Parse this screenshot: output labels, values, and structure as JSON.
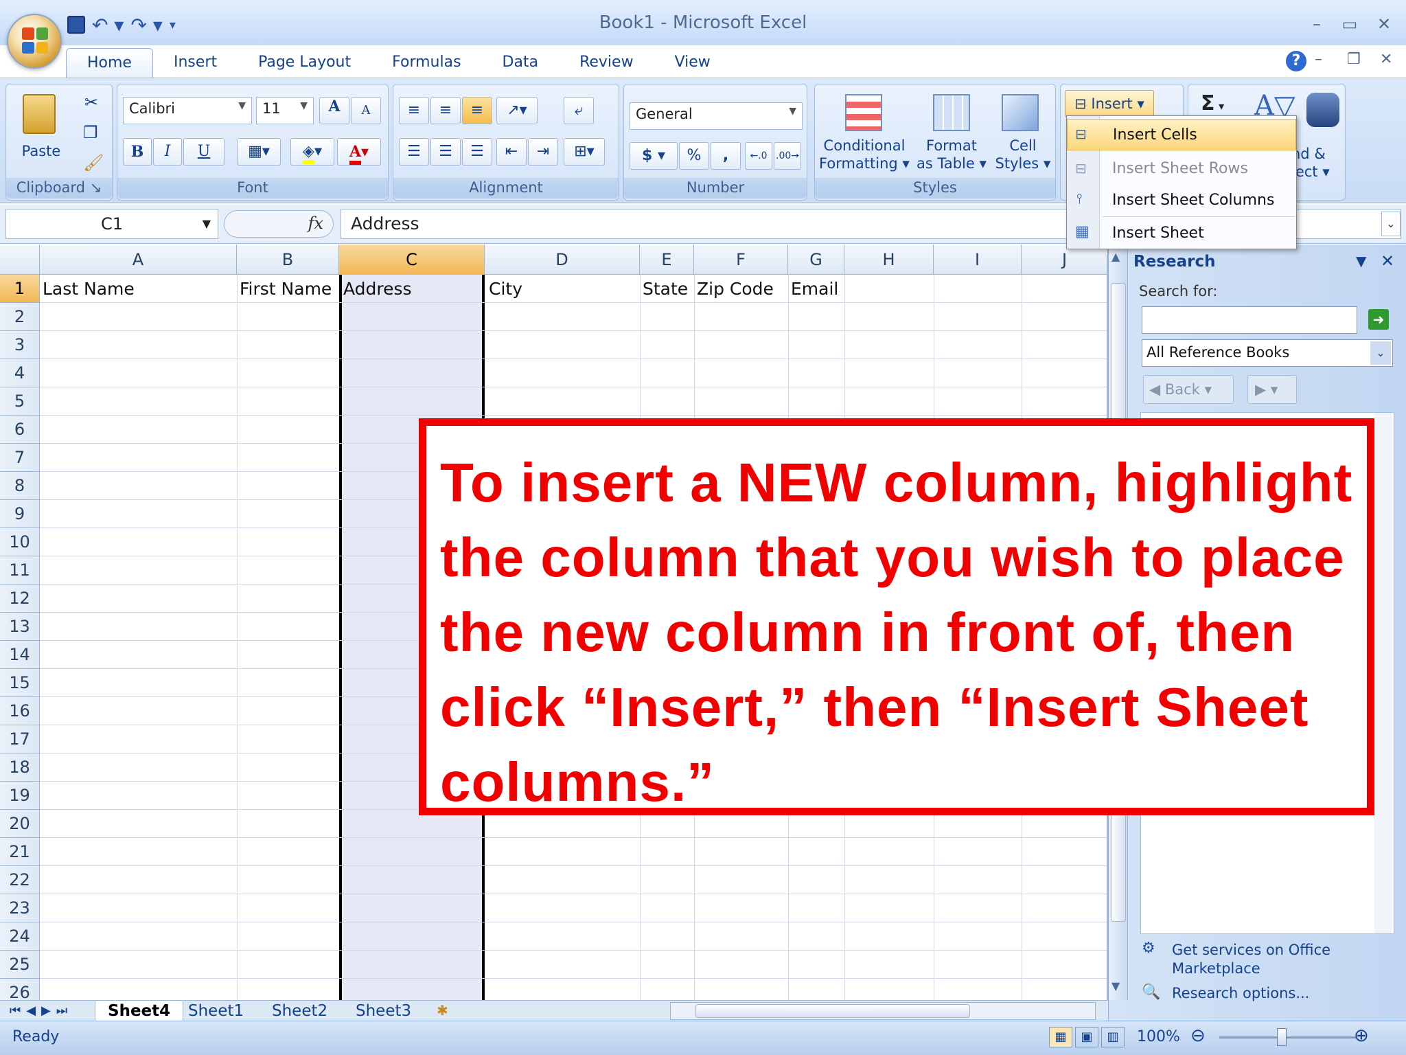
{
  "window": {
    "title": "Book1 - Microsoft Excel"
  },
  "qat": {
    "icons": [
      "save-icon",
      "undo-icon",
      "redo-icon"
    ]
  },
  "tabs": [
    "Home",
    "Insert",
    "Page Layout",
    "Formulas",
    "Data",
    "Review",
    "View"
  ],
  "ribbon": {
    "clipboard": {
      "label": "Clipboard",
      "paste": "Paste"
    },
    "font": {
      "label": "Font",
      "name": "Calibri",
      "size": "11",
      "bold": "B",
      "italic": "I",
      "underline": "U",
      "grow": "A",
      "shrink": "A"
    },
    "alignment": {
      "label": "Alignment"
    },
    "number": {
      "label": "Number",
      "format": "General",
      "currency": "$",
      "percent": "%",
      "comma": ","
    },
    "styles": {
      "label": "Styles",
      "conditional": [
        "Conditional",
        "Formatting"
      ],
      "format_table": [
        "Format",
        "as Table"
      ],
      "cell_styles": [
        "Cell",
        "Styles"
      ]
    },
    "cells": {
      "insert": "Insert"
    },
    "editing": {
      "sigma": "Σ",
      "find_partial": [
        "nd &",
        "lect"
      ]
    }
  },
  "insert_menu": [
    "Insert Cells",
    "Insert Sheet Rows",
    "Insert Sheet Columns",
    "Insert Sheet"
  ],
  "formula_bar": {
    "name_box": "C1",
    "fx": "fx",
    "value": "Address"
  },
  "grid": {
    "columns": [
      "A",
      "B",
      "C",
      "D",
      "E",
      "F",
      "G",
      "H",
      "I",
      "J"
    ],
    "rows": [
      "1",
      "2",
      "3",
      "4",
      "5",
      "6",
      "7",
      "8",
      "9",
      "10",
      "11",
      "12",
      "13",
      "14",
      "15",
      "16",
      "17",
      "18",
      "19",
      "20",
      "21",
      "22",
      "23",
      "24",
      "25",
      "26"
    ],
    "row1": [
      "Last Name",
      "First Name",
      "Address",
      "City",
      "State",
      "Zip Code",
      "Email"
    ]
  },
  "sheets": [
    "Sheet4",
    "Sheet1",
    "Sheet2",
    "Sheet3"
  ],
  "research": {
    "title": "Research",
    "search_for": "Search for:",
    "source": "All Reference Books",
    "back": "Back",
    "links": [
      "Get services on Office",
      "Marketplace",
      "Research options..."
    ]
  },
  "status": {
    "ready": "Ready",
    "zoom": "100%"
  },
  "callout": {
    "text": "To insert a NEW column, highlight the column that you wish to place the new column in front of, then click “Insert,” then “Insert Sheet columns.”"
  }
}
